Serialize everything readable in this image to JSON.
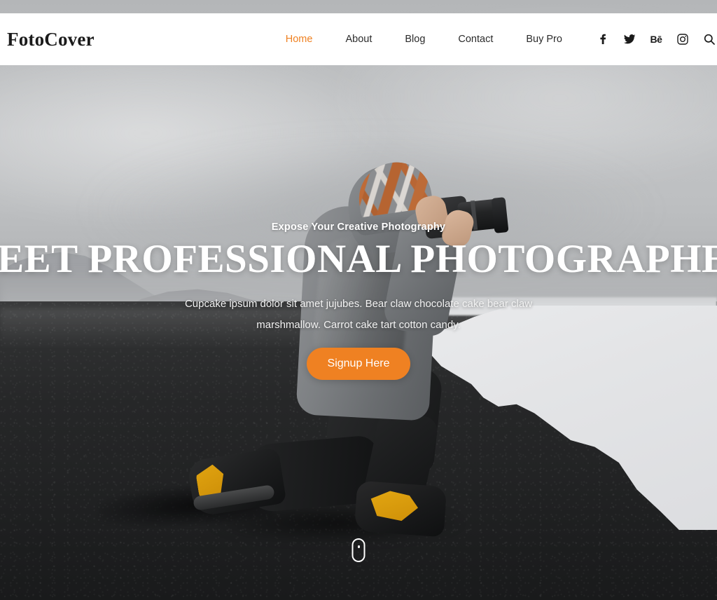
{
  "site": {
    "logo": "FotoCover"
  },
  "nav": {
    "items": [
      {
        "label": "Home",
        "active": true
      },
      {
        "label": "About",
        "active": false
      },
      {
        "label": "Blog",
        "active": false
      },
      {
        "label": "Contact",
        "active": false
      },
      {
        "label": "Buy Pro",
        "active": false
      }
    ]
  },
  "socials": [
    {
      "name": "facebook-icon",
      "glyph": "f"
    },
    {
      "name": "twitter-icon",
      "glyph": "t"
    },
    {
      "name": "behance-icon",
      "glyph": "Bē"
    },
    {
      "name": "instagram-icon",
      "glyph": "ig"
    },
    {
      "name": "search-icon",
      "glyph": "q"
    }
  ],
  "hero": {
    "eyebrow": "Expose Your Creative Photography",
    "headline": "MEET PROFESSIONAL PHOTOGRAPHER",
    "lede": "Cupcake ipsum dolor sit amet jujubes. Bear claw chocolate cake bear claw marshmallow. Carrot cake tart cotton candy.",
    "cta_label": "Signup Here"
  },
  "colors": {
    "accent": "#ef8122",
    "header_bg": "#ffffff",
    "text_dark": "#1b1b1b",
    "text_light": "#ffffff"
  }
}
